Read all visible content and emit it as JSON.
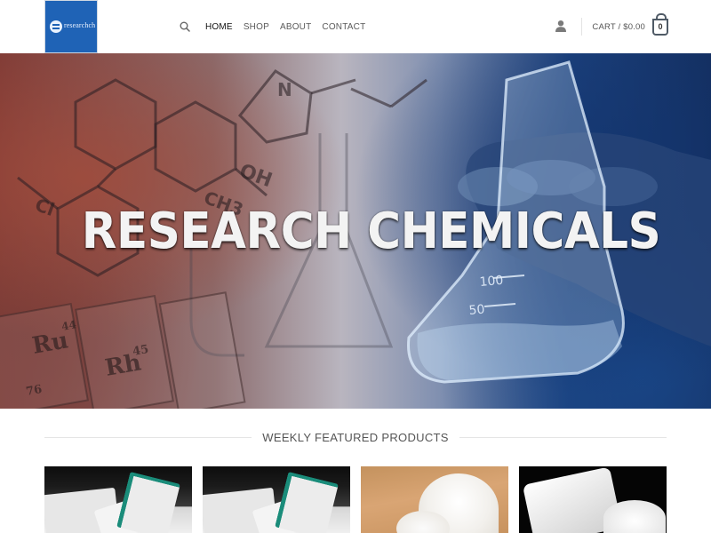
{
  "header": {
    "logo_text": "researchch",
    "nav": {
      "items": [
        {
          "label": "HOME",
          "active": true
        },
        {
          "label": "SHOP",
          "active": false
        },
        {
          "label": "ABOUT",
          "active": false
        },
        {
          "label": "CONTACT",
          "active": false
        }
      ]
    },
    "cart": {
      "label": "CART / $0.00",
      "count": "0"
    },
    "icons": {
      "search": "search-icon",
      "account": "user-icon",
      "cart": "cart-bag-icon"
    }
  },
  "hero": {
    "title": "RESEARCH CHEMICALS",
    "element_symbols": [
      "Ru",
      "Rh",
      "45",
      "44",
      "76"
    ],
    "beaker_marks": [
      "100",
      "50"
    ],
    "molecule_labels": [
      "N",
      "OH",
      "CH3",
      "Cl"
    ]
  },
  "featured": {
    "title": "WEEKLY FEATURED PRODUCTS",
    "products": [
      {
        "image": "white-powder-bags"
      },
      {
        "image": "white-powder-bags"
      },
      {
        "image": "white-powder-pile"
      },
      {
        "image": "powder-bag-on-black"
      }
    ]
  },
  "colors": {
    "logo_bg": "#1f63b6",
    "nav_text": "#5a5a5a",
    "active_nav": "#111111",
    "hero_left": "#7d3a36",
    "hero_right": "#142f60"
  }
}
